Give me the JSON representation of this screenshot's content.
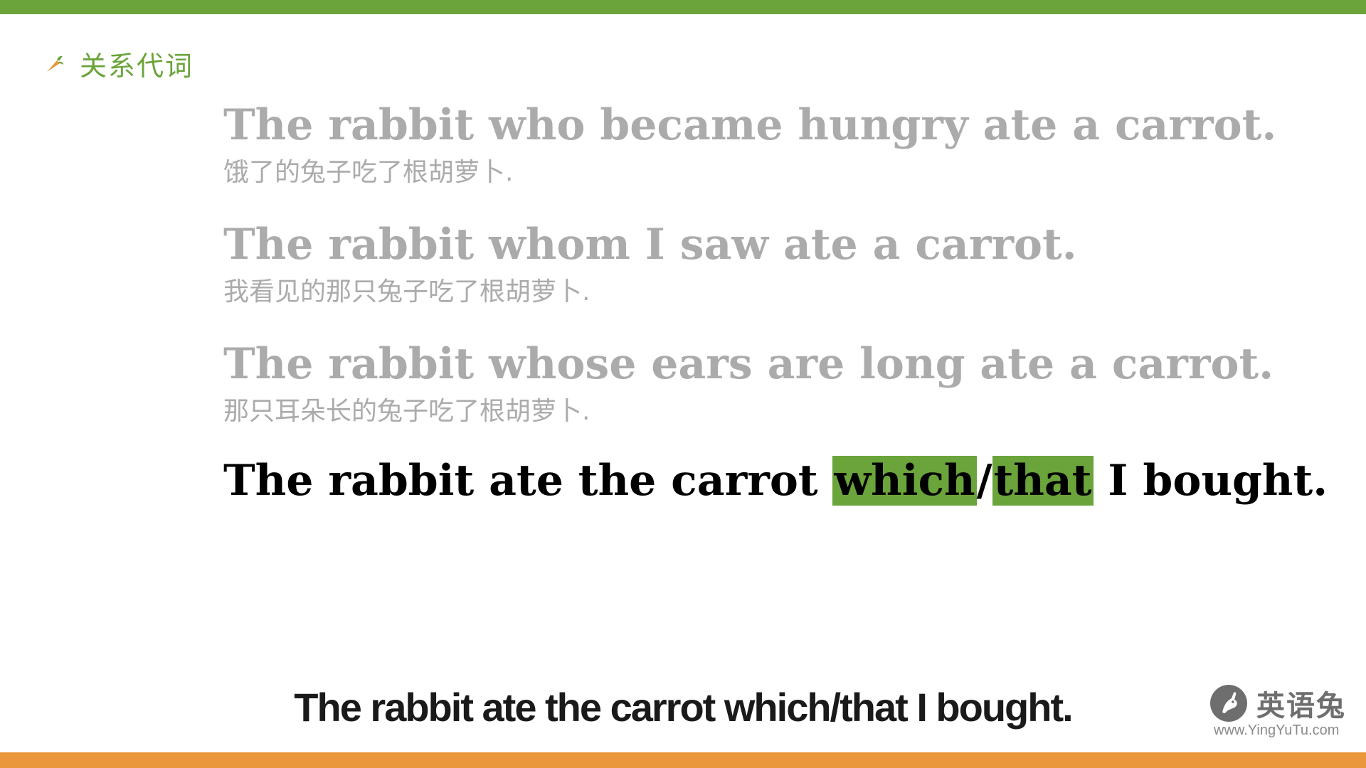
{
  "section": {
    "title": "关系代词"
  },
  "examples": [
    {
      "en": "The rabbit who became hungry ate a carrot.",
      "zh": "饿了的兔子吃了根胡萝卜."
    },
    {
      "en": "The rabbit whom I saw ate a carrot.",
      "zh": "我看见的那只兔子吃了根胡萝卜."
    },
    {
      "en": "The rabbit whose ears are long ate a carrot.",
      "zh": "那只耳朵长的兔子吃了根胡萝卜."
    }
  ],
  "focus": {
    "before": "The rabbit ate the carrot ",
    "highlight1": "which",
    "slash": "/",
    "highlight2": "that",
    "after": " I bought."
  },
  "subtitle": "The rabbit ate the carrot which/that I bought.",
  "logo": {
    "name": "英语兔",
    "url": "www.YingYuTu.com"
  },
  "colors": {
    "accent_green": "#6aa43a",
    "accent_orange": "#e9973a",
    "faded_text": "#ababab"
  },
  "icons": {
    "section_icon": "carrot-icon",
    "logo_icon": "rabbit-logo-icon"
  }
}
